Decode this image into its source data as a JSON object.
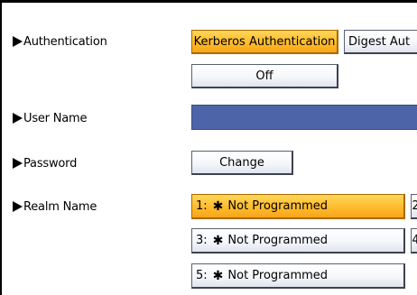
{
  "authentication": {
    "label": "Authentication",
    "options": [
      "Kerberos Authentication",
      "Digest Aut"
    ],
    "off_label": "Off"
  },
  "user_name": {
    "label": "User Name"
  },
  "password": {
    "label": "Password",
    "change_label": "Change"
  },
  "realm_name": {
    "label": "Realm Name",
    "items": [
      {
        "num": "1:",
        "text": "Not Programmed"
      },
      {
        "num": "3:",
        "text": "Not Programmed"
      },
      {
        "num": "5:",
        "text": "Not Programmed"
      }
    ],
    "side_glyphs": [
      "2",
      "4"
    ]
  },
  "colors": {
    "selected": "#ffb92a",
    "bar": "#4d64a8"
  }
}
